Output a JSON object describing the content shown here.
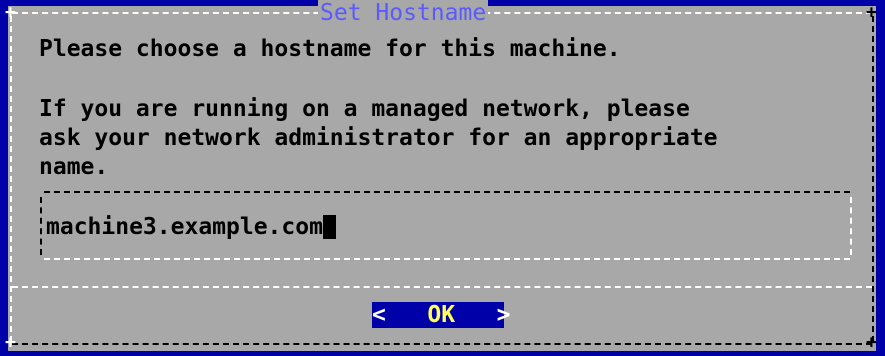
{
  "dialog": {
    "title": "Set Hostname",
    "message_lines": [
      "Please choose a hostname for this machine.",
      "If you are running on a managed network, please",
      "ask your network administrator for an appropriate",
      "name."
    ]
  },
  "hostname_input": {
    "value": "machine3.example.com"
  },
  "ok_button": {
    "left_bracket": "<",
    "label": "OK",
    "right_bracket": ">"
  },
  "colors": {
    "background": "#0000a8",
    "dialog": "#a8a8a8",
    "title": "#5a5aff",
    "button_hotkey": "#ffff55"
  }
}
